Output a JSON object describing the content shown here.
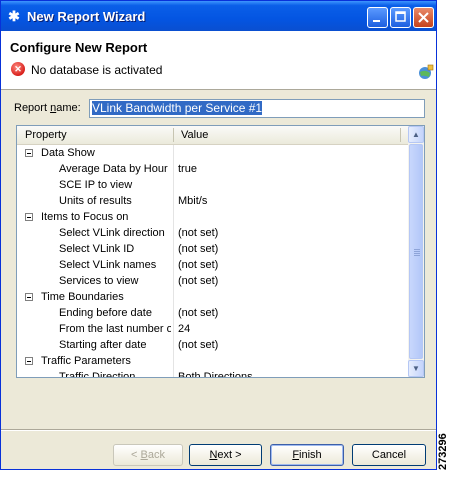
{
  "window": {
    "title": "New Report Wizard",
    "app_icon": "gear-icon"
  },
  "header": {
    "title": "Configure New Report",
    "message": "No database is activated",
    "message_icon": "error-icon",
    "wizard_icon": "wizard-globe-icon"
  },
  "report_name": {
    "label": "Report name:",
    "value": "VLink Bandwidth per Service #1"
  },
  "table": {
    "columns": [
      "Property",
      "Value"
    ],
    "rows": [
      {
        "type": "category",
        "label": "Data Show"
      },
      {
        "type": "item",
        "label": "Average Data by Hour",
        "value": "true"
      },
      {
        "type": "item",
        "label": "SCE IP to view",
        "value": ""
      },
      {
        "type": "item",
        "label": "Units of results",
        "value": "Mbit/s"
      },
      {
        "type": "category",
        "label": "Items to Focus on"
      },
      {
        "type": "item",
        "label": "Select VLink direction",
        "value": "(not set)"
      },
      {
        "type": "item",
        "label": "Select VLink ID",
        "value": "(not set)"
      },
      {
        "type": "item",
        "label": "Select VLink names",
        "value": "(not set)"
      },
      {
        "type": "item",
        "label": "Services to view",
        "value": "(not set)"
      },
      {
        "type": "category",
        "label": "Time Boundaries"
      },
      {
        "type": "item",
        "label": "Ending before date",
        "value": "(not set)"
      },
      {
        "type": "item",
        "label": "From the last number o",
        "value": "24"
      },
      {
        "type": "item",
        "label": "Starting after date",
        "value": "(not set)"
      },
      {
        "type": "category",
        "label": "Traffic Parameters"
      },
      {
        "type": "item",
        "label": "Traffic Direction",
        "value": "Both Directions"
      }
    ]
  },
  "buttons": {
    "back": "< Back",
    "next": "Next >",
    "finish": "Finish",
    "cancel": "Cancel"
  },
  "side_id": "273296"
}
